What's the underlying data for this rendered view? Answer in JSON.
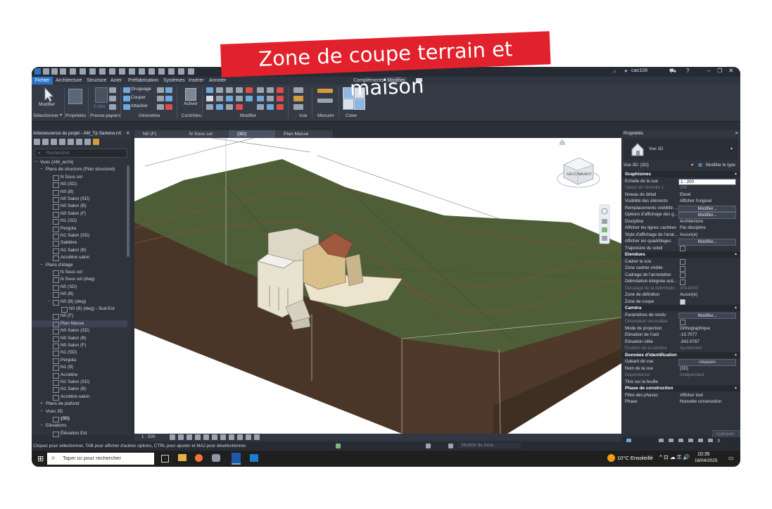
{
  "banner": {
    "text": "Zone de coupe terrain et maison"
  },
  "colors": {
    "banner": "#e1212b",
    "accent": "#2a74c8",
    "terrain": "#4e5f38",
    "soil": "#4a3628"
  },
  "titlebar": {
    "user": "cao108"
  },
  "menu": {
    "items": [
      "Fichier",
      "Architecture",
      "Structure",
      "Acier",
      "Préfabrication",
      "Systèmes",
      "Insérer",
      "Annoter",
      "Compléments",
      "Modifier"
    ]
  },
  "ribbon": {
    "modifier": "Modifier",
    "selectionner": "Sélectionner",
    "proprietes": "Propriétés",
    "coller": "Coller",
    "presse_papiers": "Presse-papiers",
    "grugeage": "Grugeage",
    "couper": "Couper",
    "attacher": "Attacher",
    "geometrie": "Géométrie",
    "activer": "Activer",
    "controles": "Contrôles",
    "modifier_group": "Modifier",
    "vue": "Vue",
    "mesurer": "Mesurer",
    "creer": "Créer"
  },
  "browser": {
    "title": "Arborescence du projet - AM_Tp Sartene.rvt",
    "search_placeholder": "Rechercher",
    "items": [
      {
        "label": "Vues (AM_archi)",
        "level": 1,
        "toggle": "−"
      },
      {
        "label": "Plans de structure (Plan structurel)",
        "level": 2,
        "toggle": "−"
      },
      {
        "label": "N Sous sol",
        "level": 3
      },
      {
        "label": "N0 (SD)",
        "level": 3
      },
      {
        "label": "N0 (B)",
        "level": 3
      },
      {
        "label": "N0 Salon (SD)",
        "level": 3
      },
      {
        "label": "N0 Salon (B)",
        "level": 3
      },
      {
        "label": "N0 Salon (F)",
        "level": 3
      },
      {
        "label": "N1 (SD)",
        "level": 3
      },
      {
        "label": "Pergola",
        "level": 3
      },
      {
        "label": "N1 Salon (SD)",
        "level": 3
      },
      {
        "label": "Sablière",
        "level": 3
      },
      {
        "label": "N1 Salon (B)",
        "level": 3
      },
      {
        "label": "Acrotère salon",
        "level": 3
      },
      {
        "label": "Plans d'étage",
        "level": 2,
        "toggle": "−"
      },
      {
        "label": "N Sous sol",
        "level": 3
      },
      {
        "label": "N Sous sol (dwg)",
        "level": 3
      },
      {
        "label": "N0 (SD)",
        "level": 3
      },
      {
        "label": "N0 (B)",
        "level": 3
      },
      {
        "label": "N0 (B) (dwg)",
        "level": 3,
        "toggle": "−"
      },
      {
        "label": "N0 (B) (dwg) - Sud-Est",
        "level": 4
      },
      {
        "label": "N0 (F)",
        "level": 3
      },
      {
        "label": "Plan Masse",
        "level": 3,
        "selected": true
      },
      {
        "label": "N0 Salon (SD)",
        "level": 3
      },
      {
        "label": "N0 Salon (B)",
        "level": 3
      },
      {
        "label": "N0 Salon (F)",
        "level": 3
      },
      {
        "label": "N1 (SD)",
        "level": 3
      },
      {
        "label": "Pergola",
        "level": 3
      },
      {
        "label": "N1 (B)",
        "level": 3
      },
      {
        "label": "Acrotère",
        "level": 3
      },
      {
        "label": "N1 Salon (SD)",
        "level": 3
      },
      {
        "label": "N1 Salon (B)",
        "level": 3
      },
      {
        "label": "Acrotère salon",
        "level": 3
      },
      {
        "label": "Plans de plafond",
        "level": 2,
        "toggle": "+"
      },
      {
        "label": "Vues 3D",
        "level": 2,
        "toggle": "−"
      },
      {
        "label": "{3D}",
        "level": 3,
        "bold": true
      },
      {
        "label": "Elévations",
        "level": 2,
        "toggle": "−"
      },
      {
        "label": "Élévation Est",
        "level": 3
      }
    ]
  },
  "tabs": [
    {
      "label": "N0 (F)",
      "active": false
    },
    {
      "label": "N Sous sol",
      "active": false
    },
    {
      "label": "{3D}",
      "active": true
    },
    {
      "label": "Plan Masse",
      "active": false
    }
  ],
  "viewcube": {
    "left": "GAUCHE",
    "front": "AVANT"
  },
  "view_control_bar": {
    "scale": "1 : 200"
  },
  "properties": {
    "title": "Propriétés",
    "type_name": "Vue 3D",
    "selector": "Vue 3D: {3D}",
    "edit_type": "Modifier le type",
    "apply": "Appliquer",
    "categories": [
      {
        "name": "Graphismes",
        "rows": [
          {
            "key": "Echelle de la vue",
            "value": "1 : 200",
            "kind": "input"
          },
          {
            "key": "Valeur de l'échelle    1:",
            "value": "200",
            "dim": true
          },
          {
            "key": "Niveau de détail",
            "value": "Elevé"
          },
          {
            "key": "Visibilité des éléments",
            "value": "Afficher l'original"
          },
          {
            "key": "Remplacements visibilité ...",
            "value": "Modifier...",
            "kind": "button"
          },
          {
            "key": "Options d'affichage des g...",
            "value": "Modifier...",
            "kind": "button"
          },
          {
            "key": "Discipline",
            "value": "Architecture"
          },
          {
            "key": "Afficher les lignes cachées",
            "value": "Par discipline"
          },
          {
            "key": "Style d'affichage de l'anal...",
            "value": "Aucun(e)"
          },
          {
            "key": "Afficher les quadrillages",
            "value": "Modifier...",
            "kind": "button"
          },
          {
            "key": "Trajectoire du soleil",
            "kind": "check",
            "checked": false
          }
        ]
      },
      {
        "name": "Etendues",
        "rows": [
          {
            "key": "Cadrer la vue",
            "kind": "check",
            "checked": false
          },
          {
            "key": "Zone cadrée visible",
            "kind": "check",
            "checked": false
          },
          {
            "key": "Cadrage de l'annotation",
            "kind": "check",
            "checked": false
          },
          {
            "key": "Délimitation éloignée acti...",
            "kind": "check",
            "checked": false
          },
          {
            "key": "Décalage de la délimitatio...",
            "value": "304.8000",
            "dim": true
          },
          {
            "key": "Zone de définition",
            "value": "Aucun(e)"
          },
          {
            "key": "Zone de coupe",
            "kind": "check",
            "checked": true
          }
        ]
      },
      {
        "name": "Caméra",
        "rows": [
          {
            "key": "Paramètres de rendu",
            "value": "Modifier...",
            "kind": "button"
          },
          {
            "key": "Orientation verrouillée",
            "kind": "check",
            "checked": false,
            "dim": true
          },
          {
            "key": "Mode de projection",
            "value": "Orthographique"
          },
          {
            "key": "Elévation de l'oeil",
            "value": "-10.7077"
          },
          {
            "key": "Elévation cible",
            "value": "-342.6767"
          },
          {
            "key": "Position de la caméra",
            "value": "Ajustement",
            "dim": true
          }
        ]
      },
      {
        "name": "Données d'identification",
        "rows": [
          {
            "key": "Gabarit de vue",
            "value": "<Aucun>",
            "kind": "button"
          },
          {
            "key": "Nom de la vue",
            "value": "{3D}"
          },
          {
            "key": "Dépendance",
            "value": "Indépendant",
            "dim": true
          },
          {
            "key": "Titre sur la feuille",
            "value": ""
          }
        ]
      },
      {
        "name": "Phase de construction",
        "rows": [
          {
            "key": "Filtre des phases",
            "value": "Afficher tout"
          },
          {
            "key": "Phase",
            "value": "Nouvelle construction"
          }
        ]
      }
    ]
  },
  "status": {
    "message": "Cliquez pour sélectionner, TAB pour afficher d'autres options, CTRL pour ajouter et MAJ pour désélectionner.",
    "model": "Modèle de base",
    "selection_count": ":0"
  },
  "taskbar": {
    "search_placeholder": "Taper ici pour rechercher",
    "weather": "10°C Ensoleillé",
    "time": "10:35",
    "date": "16/04/2025"
  }
}
